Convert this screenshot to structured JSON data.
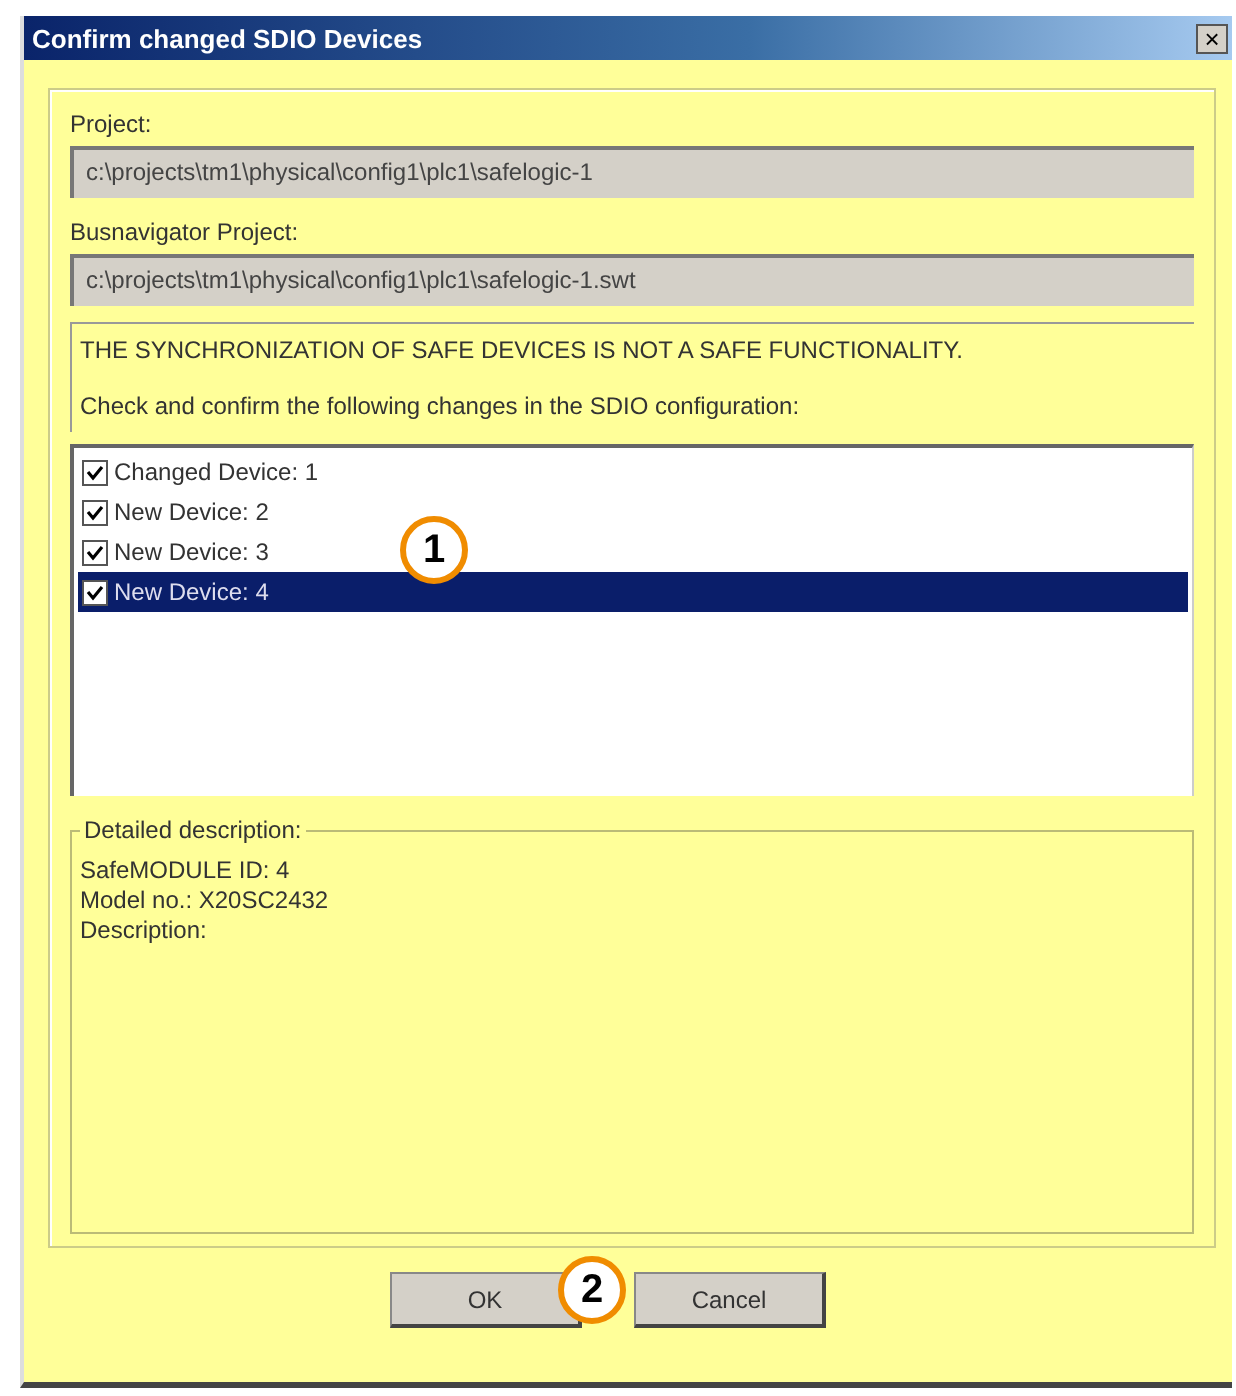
{
  "window": {
    "title": "Confirm changed SDIO Devices",
    "close": "×"
  },
  "project": {
    "label": "Project:",
    "value": "c:\\projects\\tm1\\physical\\config1\\plc1\\safelogic-1"
  },
  "busnavigator_project": {
    "label": "Busnavigator Project:",
    "value": "c:\\projects\\tm1\\physical\\config1\\plc1\\safelogic-1.swt"
  },
  "warning": "THE SYNCHRONIZATION OF SAFE DEVICES IS NOT A SAFE FUNCTIONALITY.",
  "instruction": "Check and confirm the following changes in the SDIO configuration:",
  "devices": [
    {
      "label": "Changed Device: 1",
      "checked": true,
      "selected": false
    },
    {
      "label": "New Device: 2",
      "checked": true,
      "selected": false
    },
    {
      "label": "New Device: 3",
      "checked": true,
      "selected": false
    },
    {
      "label": "New Device: 4",
      "checked": true,
      "selected": true
    }
  ],
  "detailed_description": {
    "legend": "Detailed description:",
    "lines": [
      "SafeMODULE ID: 4",
      "Model no.: X20SC2432",
      "Description:"
    ]
  },
  "buttons": [
    "OK",
    "Cancel"
  ],
  "callouts": [
    "1",
    "2"
  ]
}
